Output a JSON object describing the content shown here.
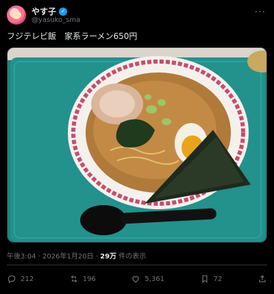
{
  "author": {
    "display_name": "やす子",
    "handle": "@yasuko_sma",
    "verified_icon": "verified-badge-icon"
  },
  "post": {
    "text": "フジテレビ飯　家系ラーメン650円",
    "image_alt": "家系ラーメン"
  },
  "meta": {
    "time": "午後3:04",
    "separator": " · ",
    "date": "2026年1月20日",
    "views_count": "29万",
    "views_label": " 件の表示"
  },
  "actions": {
    "reply_count": "212",
    "repost_count": "196",
    "like_count": "5,361",
    "bookmark_count": "72"
  },
  "colors": {
    "background": "#000000",
    "text": "#e7e9ea",
    "muted": "#71767b",
    "verified": "#1d9bf0",
    "tray": "#1f8a86"
  }
}
